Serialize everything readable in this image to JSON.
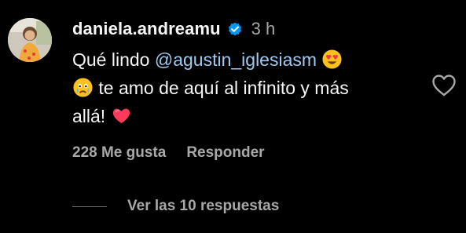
{
  "comment": {
    "username": "daniela.andreamu",
    "timestamp": "3 h",
    "text_prefix": "Qué lindo",
    "mention": "@agustin_iglesiasm",
    "text_middle": "te amo de aquí al infinito y más",
    "text_end": "allá!",
    "likes_label": "228 Me gusta",
    "reply_label": "Responder",
    "view_replies_label": "Ver las 10 respuestas"
  },
  "icons": {
    "verified": "verified-badge-icon",
    "like": "heart-outline-icon",
    "emoji_1": "heart-eyes-emoji",
    "emoji_2": "crying-face-emoji",
    "emoji_3": "red-heart-emoji"
  },
  "colors": {
    "background": "#000000",
    "text": "#f5f5f5",
    "secondary": "#a8a8a8",
    "mention": "#9fc9f0",
    "verified": "#0095f6",
    "heart": "#ff3b5c"
  }
}
